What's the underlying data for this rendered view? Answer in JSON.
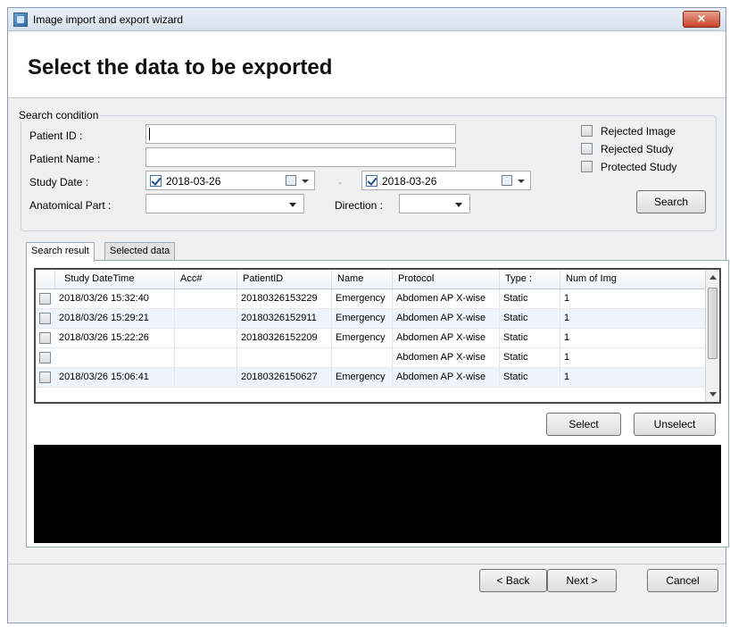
{
  "window": {
    "title": "Image import and export wizard",
    "close_label": "✕"
  },
  "header": {
    "title": "Select the data to be exported"
  },
  "search": {
    "group_label": "Search condition",
    "patient_id_label": "Patient ID :",
    "patient_id_value": "",
    "patient_name_label": "Patient Name :",
    "patient_name_value": "",
    "study_date_label": "Study Date :",
    "date_from": "2018-03-26",
    "date_to": "2018-03-26",
    "date_separator": "-",
    "anatomical_part_label": "Anatomical Part :",
    "anatomical_part_value": "",
    "direction_label": "Direction :",
    "direction_value": "",
    "options": [
      {
        "label": "Rejected Image",
        "checked": false
      },
      {
        "label": "Rejected Study",
        "checked": false
      },
      {
        "label": "Protected Study",
        "checked": false
      }
    ],
    "search_button": "Search"
  },
  "tabs": [
    {
      "label": "Search result",
      "active": true
    },
    {
      "label": "Selected data",
      "active": false
    }
  ],
  "table": {
    "columns": [
      "Study DateTime",
      "Acc#",
      "PatientID",
      "Name",
      "Protocol",
      "Type :",
      "Num of Img"
    ],
    "rows": [
      [
        "2018/03/26 15:32:40",
        "",
        "20180326153229",
        "Emergency",
        "Abdomen AP X-wise",
        "Static",
        "1"
      ],
      [
        "2018/03/26 15:29:21",
        "",
        "20180326152911",
        "Emergency",
        "Abdomen AP X-wise",
        "Static",
        "1"
      ],
      [
        "2018/03/26 15:22:26",
        "",
        "20180326152209",
        "Emergency",
        "Abdomen AP X-wise",
        "Static",
        "1"
      ],
      [
        "",
        "",
        "",
        "",
        "Abdomen AP X-wise",
        "Static",
        "1"
      ],
      [
        "2018/03/26 15:06:41",
        "",
        "20180326150627",
        "Emergency",
        "Abdomen AP X-wise",
        "Static",
        "1"
      ]
    ]
  },
  "actions": {
    "select": "Select",
    "unselect": "Unselect"
  },
  "footer": {
    "back": "< Back",
    "next": "Next >",
    "cancel": "Cancel"
  }
}
